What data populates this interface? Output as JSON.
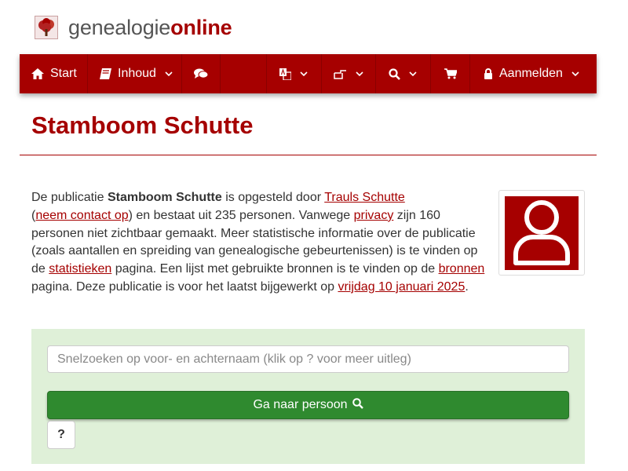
{
  "brand": {
    "part1": "genealogie",
    "part2": "online",
    "logo_icon": "tree-icon"
  },
  "nav": {
    "start_label": "Start",
    "inhoud_label": "Inhoud",
    "login_label": "Aanmelden",
    "icons": [
      "home-icon",
      "book-icon",
      "comments-icon",
      "language-icon",
      "hand-pointer-icon",
      "search-icon",
      "cart-icon",
      "lock-icon"
    ]
  },
  "page": {
    "title": "Stamboom Schutte"
  },
  "description": {
    "t1": "De publicatie ",
    "pub_name": "Stamboom Schutte",
    "t2": " is opgesteld door ",
    "author_link": "Trauls Schutte",
    "t3": " (",
    "contact_link": "neem contact op",
    "t4": ") en bestaat uit 235 personen. Vanwege ",
    "privacy_link": "privacy",
    "t5": " zijn 160 personen niet zichtbaar gemaakt. Meer statistische informatie over de publicatie (zoals aantallen en spreiding van genealogische gebeurtenissen) is te vinden op de ",
    "stats_link": "statistieken",
    "t6": " pagina. Een lijst met gebruikte bronnen is te vinden op de ",
    "sources_link": "bronnen",
    "t7": " pagina. Deze publicatie is voor het laatst bijgewerkt op ",
    "date_link": "vrijdag 10 januari 2025",
    "t8": "."
  },
  "search": {
    "placeholder": "Snelzoeken op voor- en achternaam (klik op ? voor meer uitleg)",
    "button_label": "Ga naar persoon",
    "help_label": "?"
  },
  "colors": {
    "brand_red": "#a60000",
    "panel_green": "#dff0d8",
    "button_green": "#2f8a2f"
  }
}
